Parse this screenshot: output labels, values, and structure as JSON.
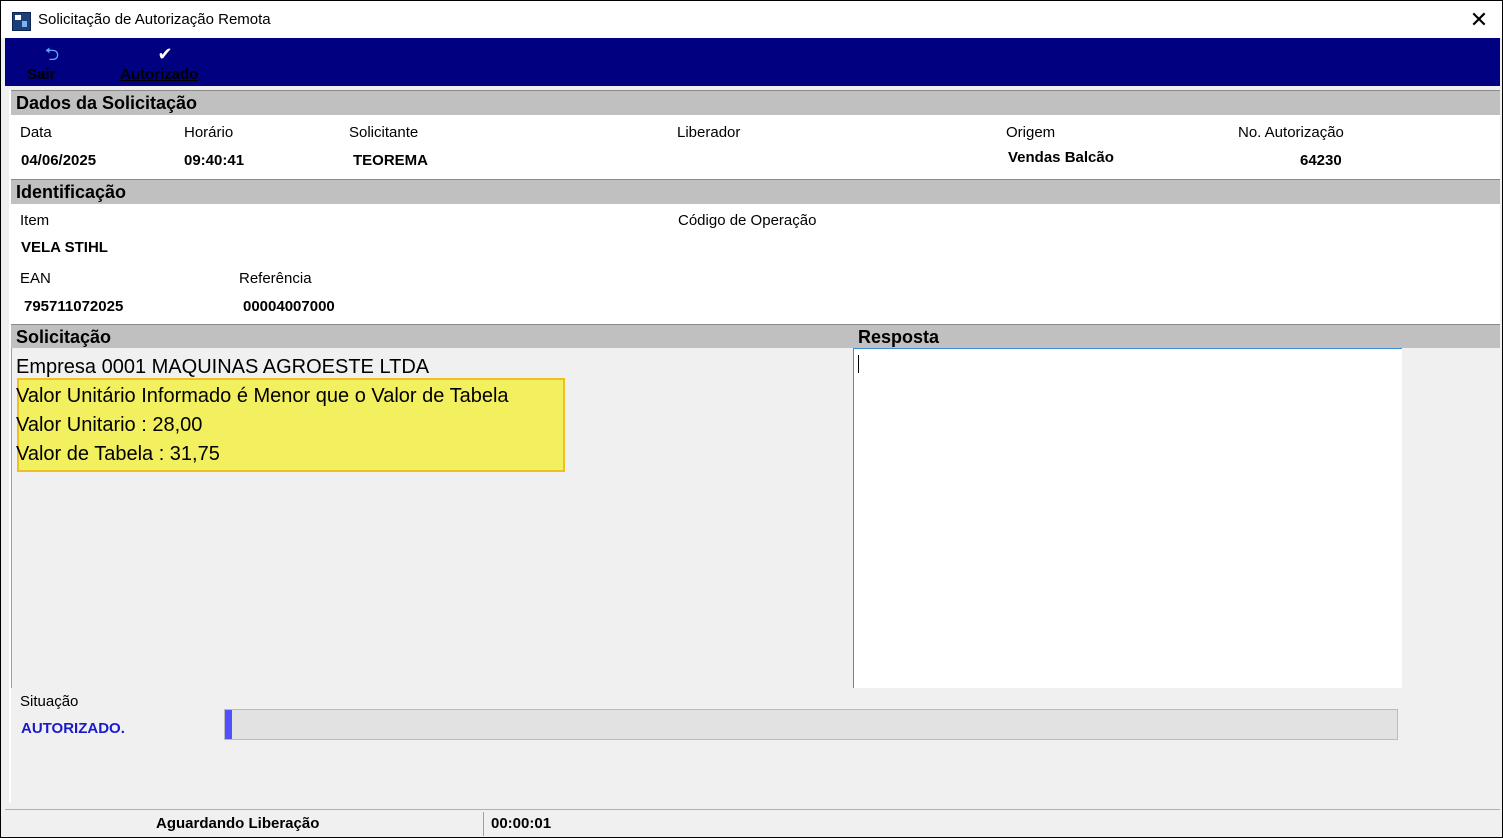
{
  "window": {
    "title": "Solicitação de Autorização Remota",
    "close_symbol": "✕"
  },
  "toolbar": {
    "exit": {
      "label": "Sair",
      "icon": "return-arrow-icon"
    },
    "authorized": {
      "label": "Autorizado",
      "icon": "checkmark-icon"
    }
  },
  "request_data": {
    "header": "Dados da Solicitação",
    "date_label": "Data",
    "date_value": "04/06/2025",
    "time_label": "Horário",
    "time_value": "09:40:41",
    "requester_label": "Solicitante",
    "requester_value": "TEOREMA",
    "releaser_label": "Liberador",
    "releaser_value": "",
    "origin_label": "Origem",
    "origin_value": "Vendas Balcão",
    "auth_no_label": "No. Autorização",
    "auth_no_value": "64230"
  },
  "identification": {
    "header": "Identificação",
    "item_label": "Item",
    "item_value": "VELA STIHL",
    "op_code_label": "Código de Operação",
    "op_code_value": "",
    "ean_label": "EAN",
    "ean_value": "795711072025",
    "reference_label": "Referência",
    "reference_value": "00004007000"
  },
  "request": {
    "header": "Solicitação",
    "lines": [
      "Empresa 0001 MAQUINAS AGROESTE LTDA",
      "Valor Unitário Informado é Menor que o Valor de Tabela",
      "Valor Unitario : 28,00",
      "Valor de Tabela : 31,75"
    ],
    "highlight_color": "#f3f060"
  },
  "response": {
    "header": "Resposta",
    "value": ""
  },
  "status": {
    "label": "Situação",
    "value": "AUTORIZADO.",
    "value_color": "#1a1acc",
    "progress_fraction": 0.006
  },
  "statusbar": {
    "message": "Aguardando Liberação",
    "timer": "00:00:01"
  }
}
